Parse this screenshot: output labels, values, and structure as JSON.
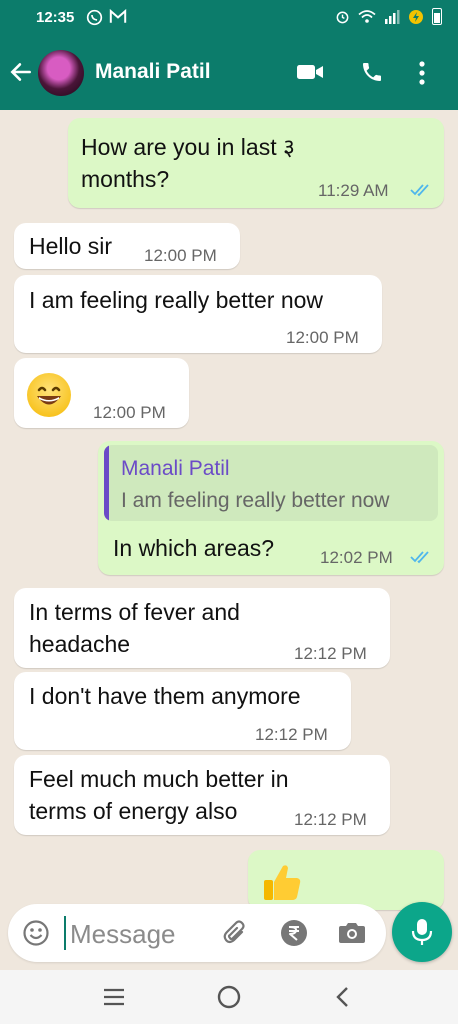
{
  "status_bar": {
    "time": "12:35",
    "left_icons": [
      "whatsapp-icon",
      "gmail-icon"
    ],
    "right_icons": [
      "alarm-icon",
      "wifi-icon",
      "signal-icon",
      "battery-saver-icon",
      "battery-icon"
    ]
  },
  "header": {
    "contact_name": "Manali Patil",
    "actions": [
      "video-call-icon",
      "voice-call-icon",
      "more-options-icon"
    ],
    "color": "#0c7c6b"
  },
  "messages": [
    {
      "direction": "out",
      "text": "How are you in last ३\nmonths?",
      "time": "11:29 AM",
      "read": true
    },
    {
      "direction": "in",
      "text": "Hello sir",
      "time": "12:00 PM"
    },
    {
      "direction": "in",
      "text": "I am feeling really better now",
      "time": "12:00 PM"
    },
    {
      "direction": "in",
      "emoji": "grinning-face-emoji",
      "time": "12:00 PM"
    },
    {
      "direction": "out",
      "reply_to": {
        "name": "Manali Patil",
        "text": "I am feeling really better now"
      },
      "text": "In which areas?",
      "time": "12:02 PM",
      "read": true
    },
    {
      "direction": "in",
      "text": "In terms of fever and\nheadache",
      "time": "12:12 PM"
    },
    {
      "direction": "in",
      "text": "I don't have them anymore",
      "time": "12:12 PM"
    },
    {
      "direction": "in",
      "text": "Feel much much better in\nterms of energy also",
      "time": "12:12 PM"
    },
    {
      "direction": "out",
      "emoji": "thumbs-up-emoji"
    }
  ],
  "composer": {
    "placeholder": "Message",
    "icons": [
      "emoji-icon",
      "attach-icon",
      "rupee-payment-icon",
      "camera-icon",
      "mic-icon"
    ]
  },
  "nav_bar": {
    "icons": [
      "recent-apps-icon",
      "home-icon",
      "back-icon"
    ]
  },
  "colors": {
    "incoming": "#ffffff",
    "outgoing": "#dcf8c6",
    "read_ticks": "#4fb6ec",
    "quote_accent": "#6b4bc7",
    "mic_button": "#0ca68a"
  }
}
